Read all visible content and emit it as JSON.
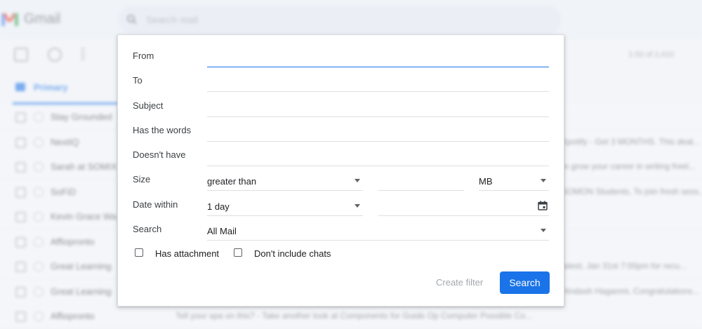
{
  "background": {
    "brand": "Gmail",
    "search_placeholder": "Search mail",
    "pager": "1-50 of 2,410",
    "tab_label": "Primary",
    "rows": [
      {
        "sender": "Stay Grounded",
        "snippet": ""
      },
      {
        "sender": "NextIQ",
        "snippet": "Spotify - Get 3 MONTHS. This deal..."
      },
      {
        "sender": "Sarah at SOMIX",
        "snippet": "to grow your career in writing freel..."
      },
      {
        "sender": "SoFiD",
        "snippet": "SOMON Students, To join fresh sess..."
      },
      {
        "sender": "Kevin Grace Wa",
        "snippet": ""
      },
      {
        "sender": "Affiopronto",
        "snippet": ""
      },
      {
        "sender": "Great Learning",
        "snippet": "latest, Jan 31st 7:00pm for recu..."
      },
      {
        "sender": "Great Learning",
        "snippet": "Hindash Haganmi, Congratulations..."
      },
      {
        "sender": "Affiopronto",
        "snippet": "Tell your spa on this? - Take another look at Components for Guide Op Computer Possible Co..."
      }
    ]
  },
  "panel": {
    "from_label": "From",
    "to_label": "To",
    "subject_label": "Subject",
    "has_words_label": "Has the words",
    "doesnt_have_label": "Doesn't have",
    "size_label": "Size",
    "size_operator": "greater than",
    "size_unit": "MB",
    "date_label": "Date within",
    "date_value": "1 day",
    "search_label": "Search",
    "search_scope": "All Mail",
    "has_attachment_label": "Has attachment",
    "no_chats_label": "Don't include chats",
    "create_filter_label": "Create filter",
    "search_button_label": "Search"
  }
}
